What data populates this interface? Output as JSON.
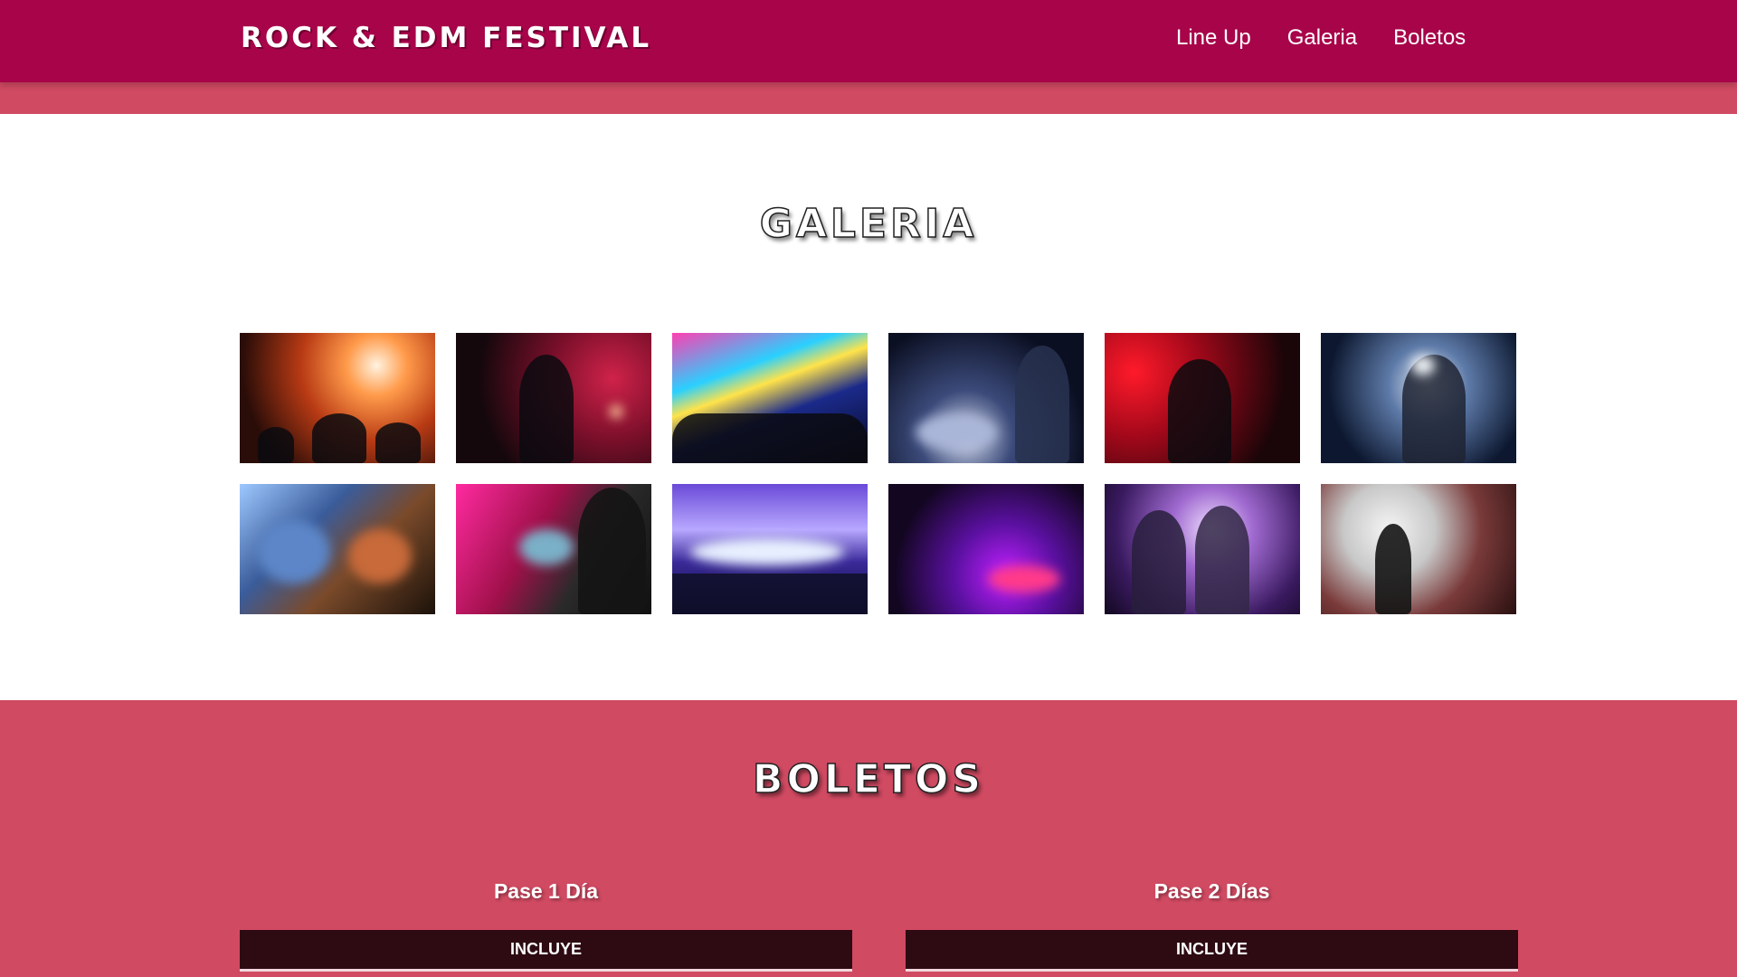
{
  "header": {
    "brand": "ROCK & EDM FESTIVAL",
    "nav": [
      "Line Up",
      "Galeria",
      "Boletos"
    ]
  },
  "galeria": {
    "title": "GALERIA",
    "photos": [
      {
        "name": "crowd-stage-lights-photo"
      },
      {
        "name": "singer-red-stage-photo"
      },
      {
        "name": "edm-stage-crowd-photo"
      },
      {
        "name": "dj-turntable-photo"
      },
      {
        "name": "guitarist-red-light-photo"
      },
      {
        "name": "female-dj-photo"
      },
      {
        "name": "guitars-closeup-photo"
      },
      {
        "name": "dj-laptop-photo"
      },
      {
        "name": "dj-mixer-hands-photo"
      },
      {
        "name": "purple-mixer-photo"
      },
      {
        "name": "rock-duo-stage-photo"
      },
      {
        "name": "singer-smoke-photo"
      }
    ]
  },
  "boletos": {
    "title": "BOLETOS",
    "passes": [
      {
        "title": "Pase 1 Día",
        "incluye": "INCLUYE"
      },
      {
        "title": "Pase 2 Días",
        "incluye": "INCLUYE"
      }
    ]
  },
  "colors": {
    "header": "#a8044a",
    "accent": "#d04a62",
    "card_header": "#2e0a12"
  }
}
